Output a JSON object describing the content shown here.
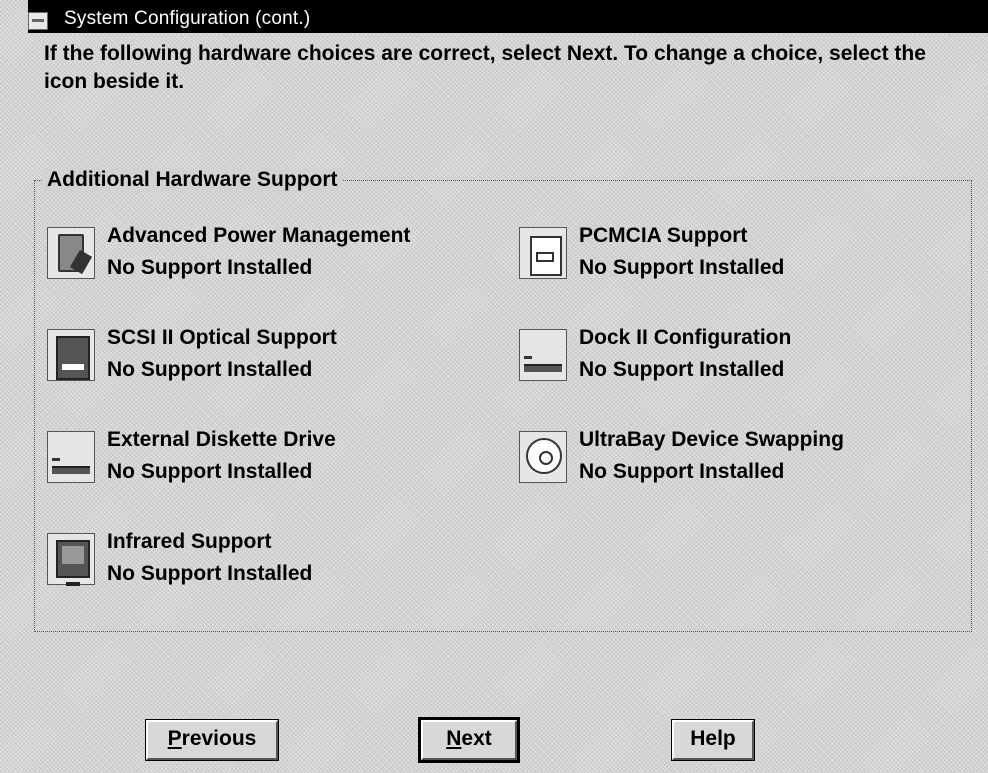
{
  "window": {
    "title": "System Configuration (cont.)"
  },
  "instructions": "If the following hardware choices are correct, select Next. To change a choice, select the icon beside it.",
  "group": {
    "label": "Additional Hardware Support",
    "items": [
      {
        "label": "Advanced Power Management",
        "status": "No Support Installed",
        "icon": "power-management-icon"
      },
      {
        "label": "PCMCIA Support",
        "status": "No Support Installed",
        "icon": "pcmcia-card-icon"
      },
      {
        "label": "SCSI II Optical Support",
        "status": "No Support Installed",
        "icon": "optical-drive-icon"
      },
      {
        "label": "Dock II Configuration",
        "status": "No Support Installed",
        "icon": "dock-icon"
      },
      {
        "label": "External Diskette Drive",
        "status": "No Support Installed",
        "icon": "diskette-drive-icon"
      },
      {
        "label": "UltraBay Device Swapping",
        "status": "No Support Installed",
        "icon": "cd-drive-icon"
      },
      {
        "label": "Infrared Support",
        "status": "No Support Installed",
        "icon": "infrared-icon"
      }
    ]
  },
  "buttons": {
    "previous": {
      "mnemonic": "P",
      "rest": "revious"
    },
    "next": {
      "mnemonic": "N",
      "rest": "ext"
    },
    "help": "Help"
  }
}
